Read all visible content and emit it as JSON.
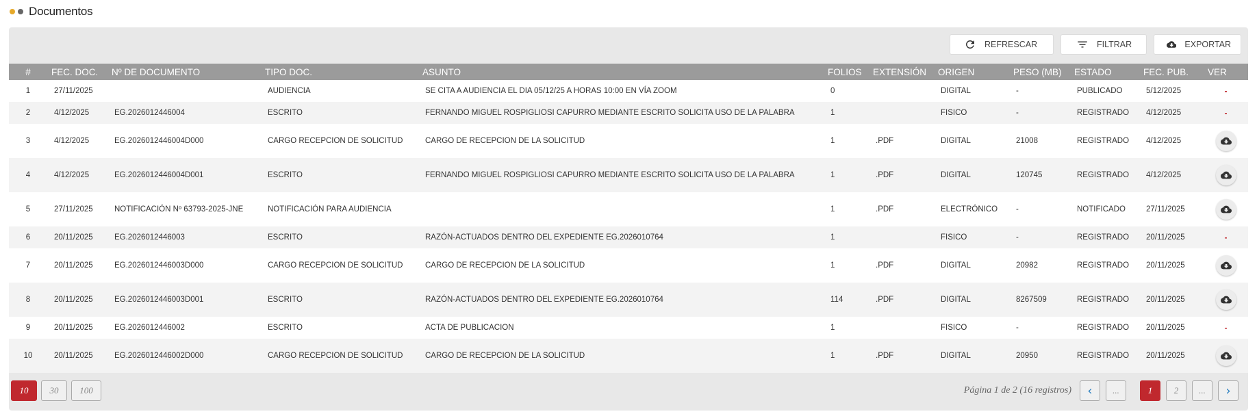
{
  "page": {
    "title": "Documentos"
  },
  "toolbar": {
    "refresh_label": "REFRESCAR",
    "filter_label": "FILTRAR",
    "export_label": "EXPORTAR"
  },
  "table": {
    "headers": [
      "#",
      "FEC. DOC.",
      "Nº DE DOCUMENTO",
      "TIPO DOC.",
      "ASUNTO",
      "FOLIOS",
      "EXTENSIÓN",
      "ORIGEN",
      "PESO (MB)",
      "ESTADO",
      "FEC. PUB.",
      "VER"
    ],
    "rows": [
      {
        "num": "1",
        "fec_doc": "27/11/2025",
        "nro_doc": "",
        "tipo": "AUDIENCIA",
        "asunto": "SE CITA A AUDIENCIA EL DIA 05/12/25 A HORAS 10:00 EN VÍA ZOOM",
        "folios": "0",
        "ext": "",
        "origen": "DIGITAL",
        "peso": "-",
        "estado": "PUBLICADO",
        "fec_pub": "5/12/2025",
        "ver": "-"
      },
      {
        "num": "2",
        "fec_doc": "4/12/2025",
        "nro_doc": "EG.2026012446004",
        "tipo": "ESCRITO",
        "asunto": "FERNANDO MIGUEL ROSPIGLIOSI CAPURRO MEDIANTE ESCRITO SOLICITA USO DE LA PALABRA",
        "folios": "1",
        "ext": "",
        "origen": "FISICO",
        "peso": "-",
        "estado": "REGISTRADO",
        "fec_pub": "4/12/2025",
        "ver": "-"
      },
      {
        "num": "3",
        "fec_doc": "4/12/2025",
        "nro_doc": "EG.2026012446004D000",
        "tipo": "CARGO RECEPCION DE SOLICITUD",
        "asunto": "CARGO DE RECEPCION DE LA SOLICITUD",
        "folios": "1",
        "ext": ".PDF",
        "origen": "DIGITAL",
        "peso": "21008",
        "estado": "REGISTRADO",
        "fec_pub": "4/12/2025",
        "ver": "download"
      },
      {
        "num": "4",
        "fec_doc": "4/12/2025",
        "nro_doc": "EG.2026012446004D001",
        "tipo": "ESCRITO",
        "asunto": "FERNANDO MIGUEL ROSPIGLIOSI CAPURRO MEDIANTE ESCRITO SOLICITA USO DE LA PALABRA",
        "folios": "1",
        "ext": ".PDF",
        "origen": "DIGITAL",
        "peso": "120745",
        "estado": "REGISTRADO",
        "fec_pub": "4/12/2025",
        "ver": "download"
      },
      {
        "num": "5",
        "fec_doc": "27/11/2025",
        "nro_doc": "NOTIFICACIÓN Nº 63793-2025-JNE",
        "tipo": "NOTIFICACIÓN PARA AUDIENCIA",
        "asunto": "",
        "folios": "1",
        "ext": ".PDF",
        "origen": "ELECTRÓNICO",
        "peso": "-",
        "estado": "NOTIFICADO",
        "fec_pub": "27/11/2025",
        "ver": "download",
        "ver_extra": "-"
      },
      {
        "num": "6",
        "fec_doc": "20/11/2025",
        "nro_doc": "EG.2026012446003",
        "tipo": "ESCRITO",
        "asunto": "RAZÓN-ACTUADOS DENTRO DEL EXPEDIENTE EG.2026010764",
        "folios": "1",
        "ext": "",
        "origen": "FISICO",
        "peso": "-",
        "estado": "REGISTRADO",
        "fec_pub": "20/11/2025",
        "ver": "-"
      },
      {
        "num": "7",
        "fec_doc": "20/11/2025",
        "nro_doc": "EG.2026012446003D000",
        "tipo": "CARGO RECEPCION DE SOLICITUD",
        "asunto": "CARGO DE RECEPCION DE LA SOLICITUD",
        "folios": "1",
        "ext": ".PDF",
        "origen": "DIGITAL",
        "peso": "20982",
        "estado": "REGISTRADO",
        "fec_pub": "20/11/2025",
        "ver": "download"
      },
      {
        "num": "8",
        "fec_doc": "20/11/2025",
        "nro_doc": "EG.2026012446003D001",
        "tipo": "ESCRITO",
        "asunto": "RAZÓN-ACTUADOS DENTRO DEL EXPEDIENTE EG.2026010764",
        "folios": "114",
        "ext": ".PDF",
        "origen": "DIGITAL",
        "peso": "8267509",
        "estado": "REGISTRADO",
        "fec_pub": "20/11/2025",
        "ver": "download"
      },
      {
        "num": "9",
        "fec_doc": "20/11/2025",
        "nro_doc": "EG.2026012446002",
        "tipo": "ESCRITO",
        "asunto": "ACTA DE PUBLICACION",
        "folios": "1",
        "ext": "",
        "origen": "FISICO",
        "peso": "-",
        "estado": "REGISTRADO",
        "fec_pub": "20/11/2025",
        "ver": "-"
      },
      {
        "num": "10",
        "fec_doc": "20/11/2025",
        "nro_doc": "EG.2026012446002D000",
        "tipo": "CARGO RECEPCION DE SOLICITUD",
        "asunto": "CARGO DE RECEPCION DE LA SOLICITUD",
        "folios": "1",
        "ext": ".PDF",
        "origen": "DIGITAL",
        "peso": "20950",
        "estado": "REGISTRADO",
        "fec_pub": "20/11/2025",
        "ver": "download"
      }
    ]
  },
  "pagination": {
    "page_sizes": [
      "10",
      "30",
      "100"
    ],
    "active_size": "10",
    "info": "Página 1 de 2 (16 registros)",
    "ellipsis": "...",
    "pages": [
      "1",
      "2"
    ],
    "current_page": "1"
  },
  "colors": {
    "accent_red": "#c0282e",
    "header_gray": "#9b9b9b",
    "link_blue": "#2a7fc0",
    "dot_orange": "#e6a92a"
  },
  "icons": {
    "refresh": "refresh-icon",
    "filter": "filter-icon",
    "export": "cloud-download-icon",
    "download": "download-icon",
    "prev": "chevron-left-icon",
    "next": "chevron-right-icon"
  }
}
